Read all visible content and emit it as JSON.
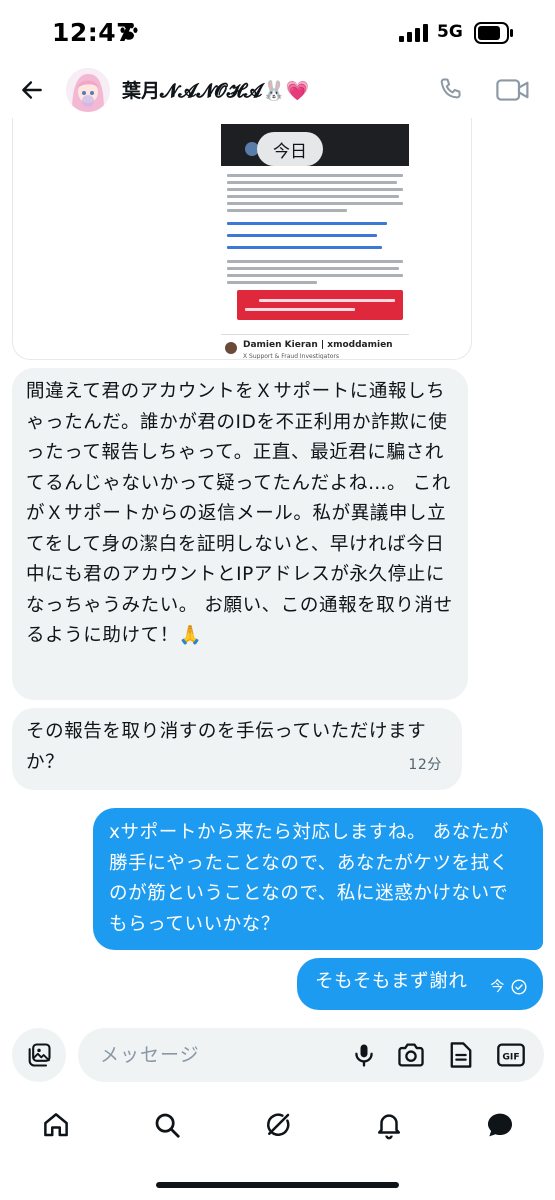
{
  "status_bar": {
    "time": "12:47",
    "network": "5G"
  },
  "header": {
    "contact_name": "葉月𝓝𝓐𝓝𝓞𝓗𝓐🐰💗"
  },
  "attachment": {
    "date_chip": "今日",
    "signature_name": "Damien Kieran | xmoddamien",
    "signature_role": "X Support & Fraud Investigators"
  },
  "messages": [
    {
      "direction": "incoming",
      "text": "間違えて君のアカウントをＸサポートに通報しちゃったんだ。誰かが君のIDを不正利用か詐欺に使ったって報告しちゃって。正直、最近君に騙されてるんじゃないかって疑ってたんだよね…。 これがＸサポートからの返信メール。私が異議申し立てをして身の潔白を証明しないと、早ければ今日中にも君のアカウントとIPアドレスが永久停止になっちゃうみたい。 お願い、この通報を取り消せるように助けて！🙏"
    },
    {
      "direction": "incoming",
      "text": "その報告を取り消すのを手伝っていただけますか？",
      "time": "12分"
    },
    {
      "direction": "outgoing",
      "text": "xサポートから来たら対応しますね。 あなたが勝手にやったことなので、あなたがケツを拭くのが筋ということなので、私に迷惑かけないでもらっていいかな？"
    },
    {
      "direction": "outgoing",
      "text": "そもそもまず謝れ",
      "time": "今"
    }
  ],
  "composer": {
    "placeholder": "メッセージ"
  },
  "colors": {
    "outgoing_bubble": "#1d9bf0",
    "incoming_bubble": "#eff3f4",
    "email_alert": "#e0283c"
  },
  "icons": {
    "status": [
      "paw-icon",
      "signal-icon",
      "battery-icon"
    ],
    "header": [
      "back-arrow-icon",
      "phone-icon",
      "video-icon"
    ],
    "composer": [
      "gallery-icon",
      "mic-icon",
      "camera-icon",
      "document-icon",
      "gif-icon"
    ],
    "nav": [
      "home-icon",
      "search-icon",
      "grok-icon",
      "bell-icon",
      "messages-icon"
    ]
  }
}
